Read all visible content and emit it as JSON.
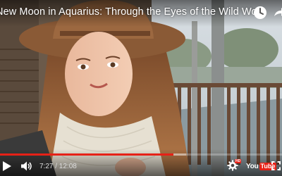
{
  "video": {
    "title": "New Moon in Aquarius: Through the Eyes of the Wild Wo...",
    "current_time": "7:27",
    "duration": "12:08",
    "time_display": "7:27 / 12:08",
    "progress_fraction": 0.614,
    "buffered_fraction": 0.66
  },
  "controls": {
    "hd_badge": "HD",
    "logo_you": "You",
    "logo_tube": "Tube"
  },
  "icons": {
    "watch_later": "clock-icon",
    "share": "share-icon",
    "play": "play-icon",
    "volume": "volume-icon",
    "settings": "gear-icon",
    "fullscreen": "fullscreen-icon"
  },
  "colors": {
    "progress": "#e62117",
    "youtube_red": "#e62117"
  }
}
